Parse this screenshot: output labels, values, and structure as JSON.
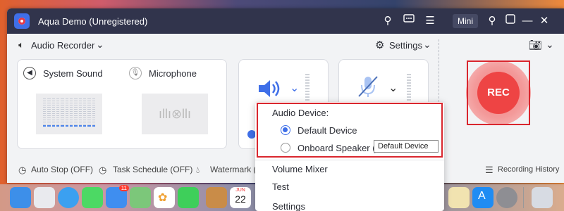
{
  "titlebar": {
    "title": "Aqua Demo (Unregistered)",
    "mini_label": "Mini",
    "icons": [
      "key-icon",
      "chat-icon",
      "menu-icon",
      "pin-icon",
      "restore-icon",
      "minimize-icon",
      "close-icon"
    ]
  },
  "header": {
    "mode_label": "Audio Recorder",
    "settings_label": "Settings"
  },
  "sources": {
    "system_sound": "System Sound",
    "microphone": "Microphone"
  },
  "dropdown": {
    "section_title": "Audio Device:",
    "options": [
      "Default Device",
      "Onboard Speaker (Au"
    ],
    "selected": "Default Device",
    "items": [
      "Volume Mixer",
      "Test",
      "Settings"
    ]
  },
  "tooltip": "Default Device",
  "rec_label": "REC",
  "footer": {
    "auto_stop": "Auto Stop (OFF)",
    "task_schedule": "Task Schedule (OFF)",
    "watermark": "Watermark (",
    "history": "Recording History"
  },
  "dock": {
    "calendar_month": "JUN",
    "calendar_day": "22",
    "mail_badge": "11"
  },
  "colors": {
    "accent": "#3f6fe8",
    "rec": "#ee4444",
    "highlight": "#d9262e",
    "titlebar": "#31344c"
  }
}
